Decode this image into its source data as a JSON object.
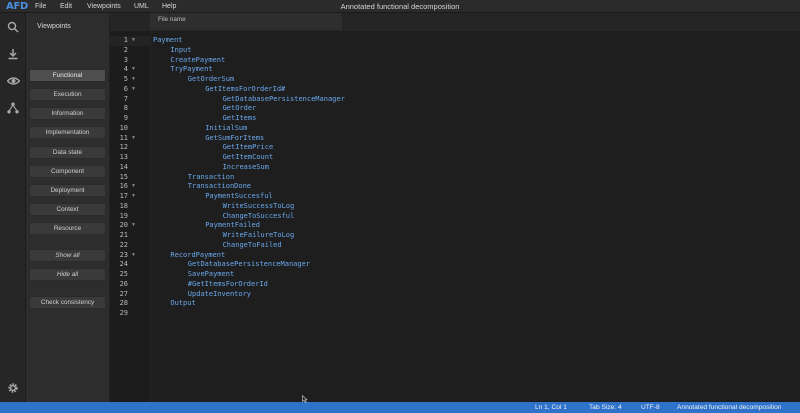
{
  "app": {
    "logo": "AFD",
    "title": "Annotated functional decomposition"
  },
  "menu": [
    "File",
    "Edit",
    "Viewpoints",
    "UML",
    "Help"
  ],
  "iconbar": [
    {
      "icon": "search-icon"
    },
    {
      "icon": "download-icon"
    },
    {
      "icon": "eye-icon"
    },
    {
      "icon": "hierarchy-icon"
    },
    {
      "icon": "gear-icon"
    }
  ],
  "viewpoints": {
    "title": "Viewpoints",
    "items": [
      "Functional",
      "Execution",
      "Information",
      "Implementation",
      "Data state",
      "Component",
      "Deployment",
      "Context",
      "Resource"
    ],
    "active": "Functional",
    "show_all": "Show all",
    "hide_all": "Hide all",
    "check": "Check consistency"
  },
  "tabs": [
    {
      "label": "File name"
    }
  ],
  "editor": {
    "lines": [
      {
        "num": "1",
        "indent": 0,
        "text": "Payment",
        "fold": true
      },
      {
        "num": "2",
        "indent": 1,
        "text": "Input",
        "fold": false
      },
      {
        "num": "3",
        "indent": 1,
        "text": "CreatePayment",
        "fold": false
      },
      {
        "num": "4",
        "indent": 1,
        "text": "TryPayment",
        "fold": true
      },
      {
        "num": "5",
        "indent": 2,
        "text": "GetOrderSum",
        "fold": true
      },
      {
        "num": "6",
        "indent": 3,
        "text": "GetItemsForOrderId#",
        "fold": true
      },
      {
        "num": "7",
        "indent": 4,
        "text": "GetDatabasePersistenceManager",
        "fold": false
      },
      {
        "num": "8",
        "indent": 4,
        "text": "GetOrder",
        "fold": false
      },
      {
        "num": "9",
        "indent": 4,
        "text": "GetItems",
        "fold": false
      },
      {
        "num": "10",
        "indent": 3,
        "text": "InitialSum",
        "fold": false
      },
      {
        "num": "11",
        "indent": 3,
        "text": "GetSumForItems",
        "fold": true
      },
      {
        "num": "12",
        "indent": 4,
        "text": "GetItemPrice",
        "fold": false
      },
      {
        "num": "13",
        "indent": 4,
        "text": "GetItemCount",
        "fold": false
      },
      {
        "num": "14",
        "indent": 4,
        "text": "IncreaseSum",
        "fold": false
      },
      {
        "num": "15",
        "indent": 2,
        "text": "Transaction",
        "fold": false
      },
      {
        "num": "16",
        "indent": 2,
        "text": "TransactionDone",
        "fold": true
      },
      {
        "num": "17",
        "indent": 3,
        "text": "PaymentSuccesful",
        "fold": true
      },
      {
        "num": "18",
        "indent": 4,
        "text": "WriteSuccessToLog",
        "fold": false
      },
      {
        "num": "19",
        "indent": 4,
        "text": "ChangeToSuccesful",
        "fold": false
      },
      {
        "num": "20",
        "indent": 3,
        "text": "PaymentFailed",
        "fold": true
      },
      {
        "num": "21",
        "indent": 4,
        "text": "WriteFailureToLog",
        "fold": false
      },
      {
        "num": "22",
        "indent": 4,
        "text": "ChangeToFailed",
        "fold": false
      },
      {
        "num": "23",
        "indent": 1,
        "text": "RecordPayment",
        "fold": true
      },
      {
        "num": "24",
        "indent": 2,
        "text": "GetDatabasePersistenceManager",
        "fold": false
      },
      {
        "num": "25",
        "indent": 2,
        "text": "SavePayment",
        "fold": false
      },
      {
        "num": "26",
        "indent": 2,
        "text": "#GetItemsForOrderId",
        "fold": false
      },
      {
        "num": "27",
        "indent": 2,
        "text": "UpdateInventory",
        "fold": false
      },
      {
        "num": "28",
        "indent": 1,
        "text": "Output",
        "fold": false
      },
      {
        "num": "29",
        "indent": 0,
        "text": "",
        "fold": false
      }
    ]
  },
  "status": {
    "position": "Ln 1,  Col 1",
    "tab_size": "Tab Size: 4",
    "encoding": "UTF-8",
    "mode": "Annotated functional decomposition"
  },
  "colors": {
    "accent": "#2f72c9",
    "code": "#6aa9ee",
    "logo": "#4a8fe0"
  }
}
